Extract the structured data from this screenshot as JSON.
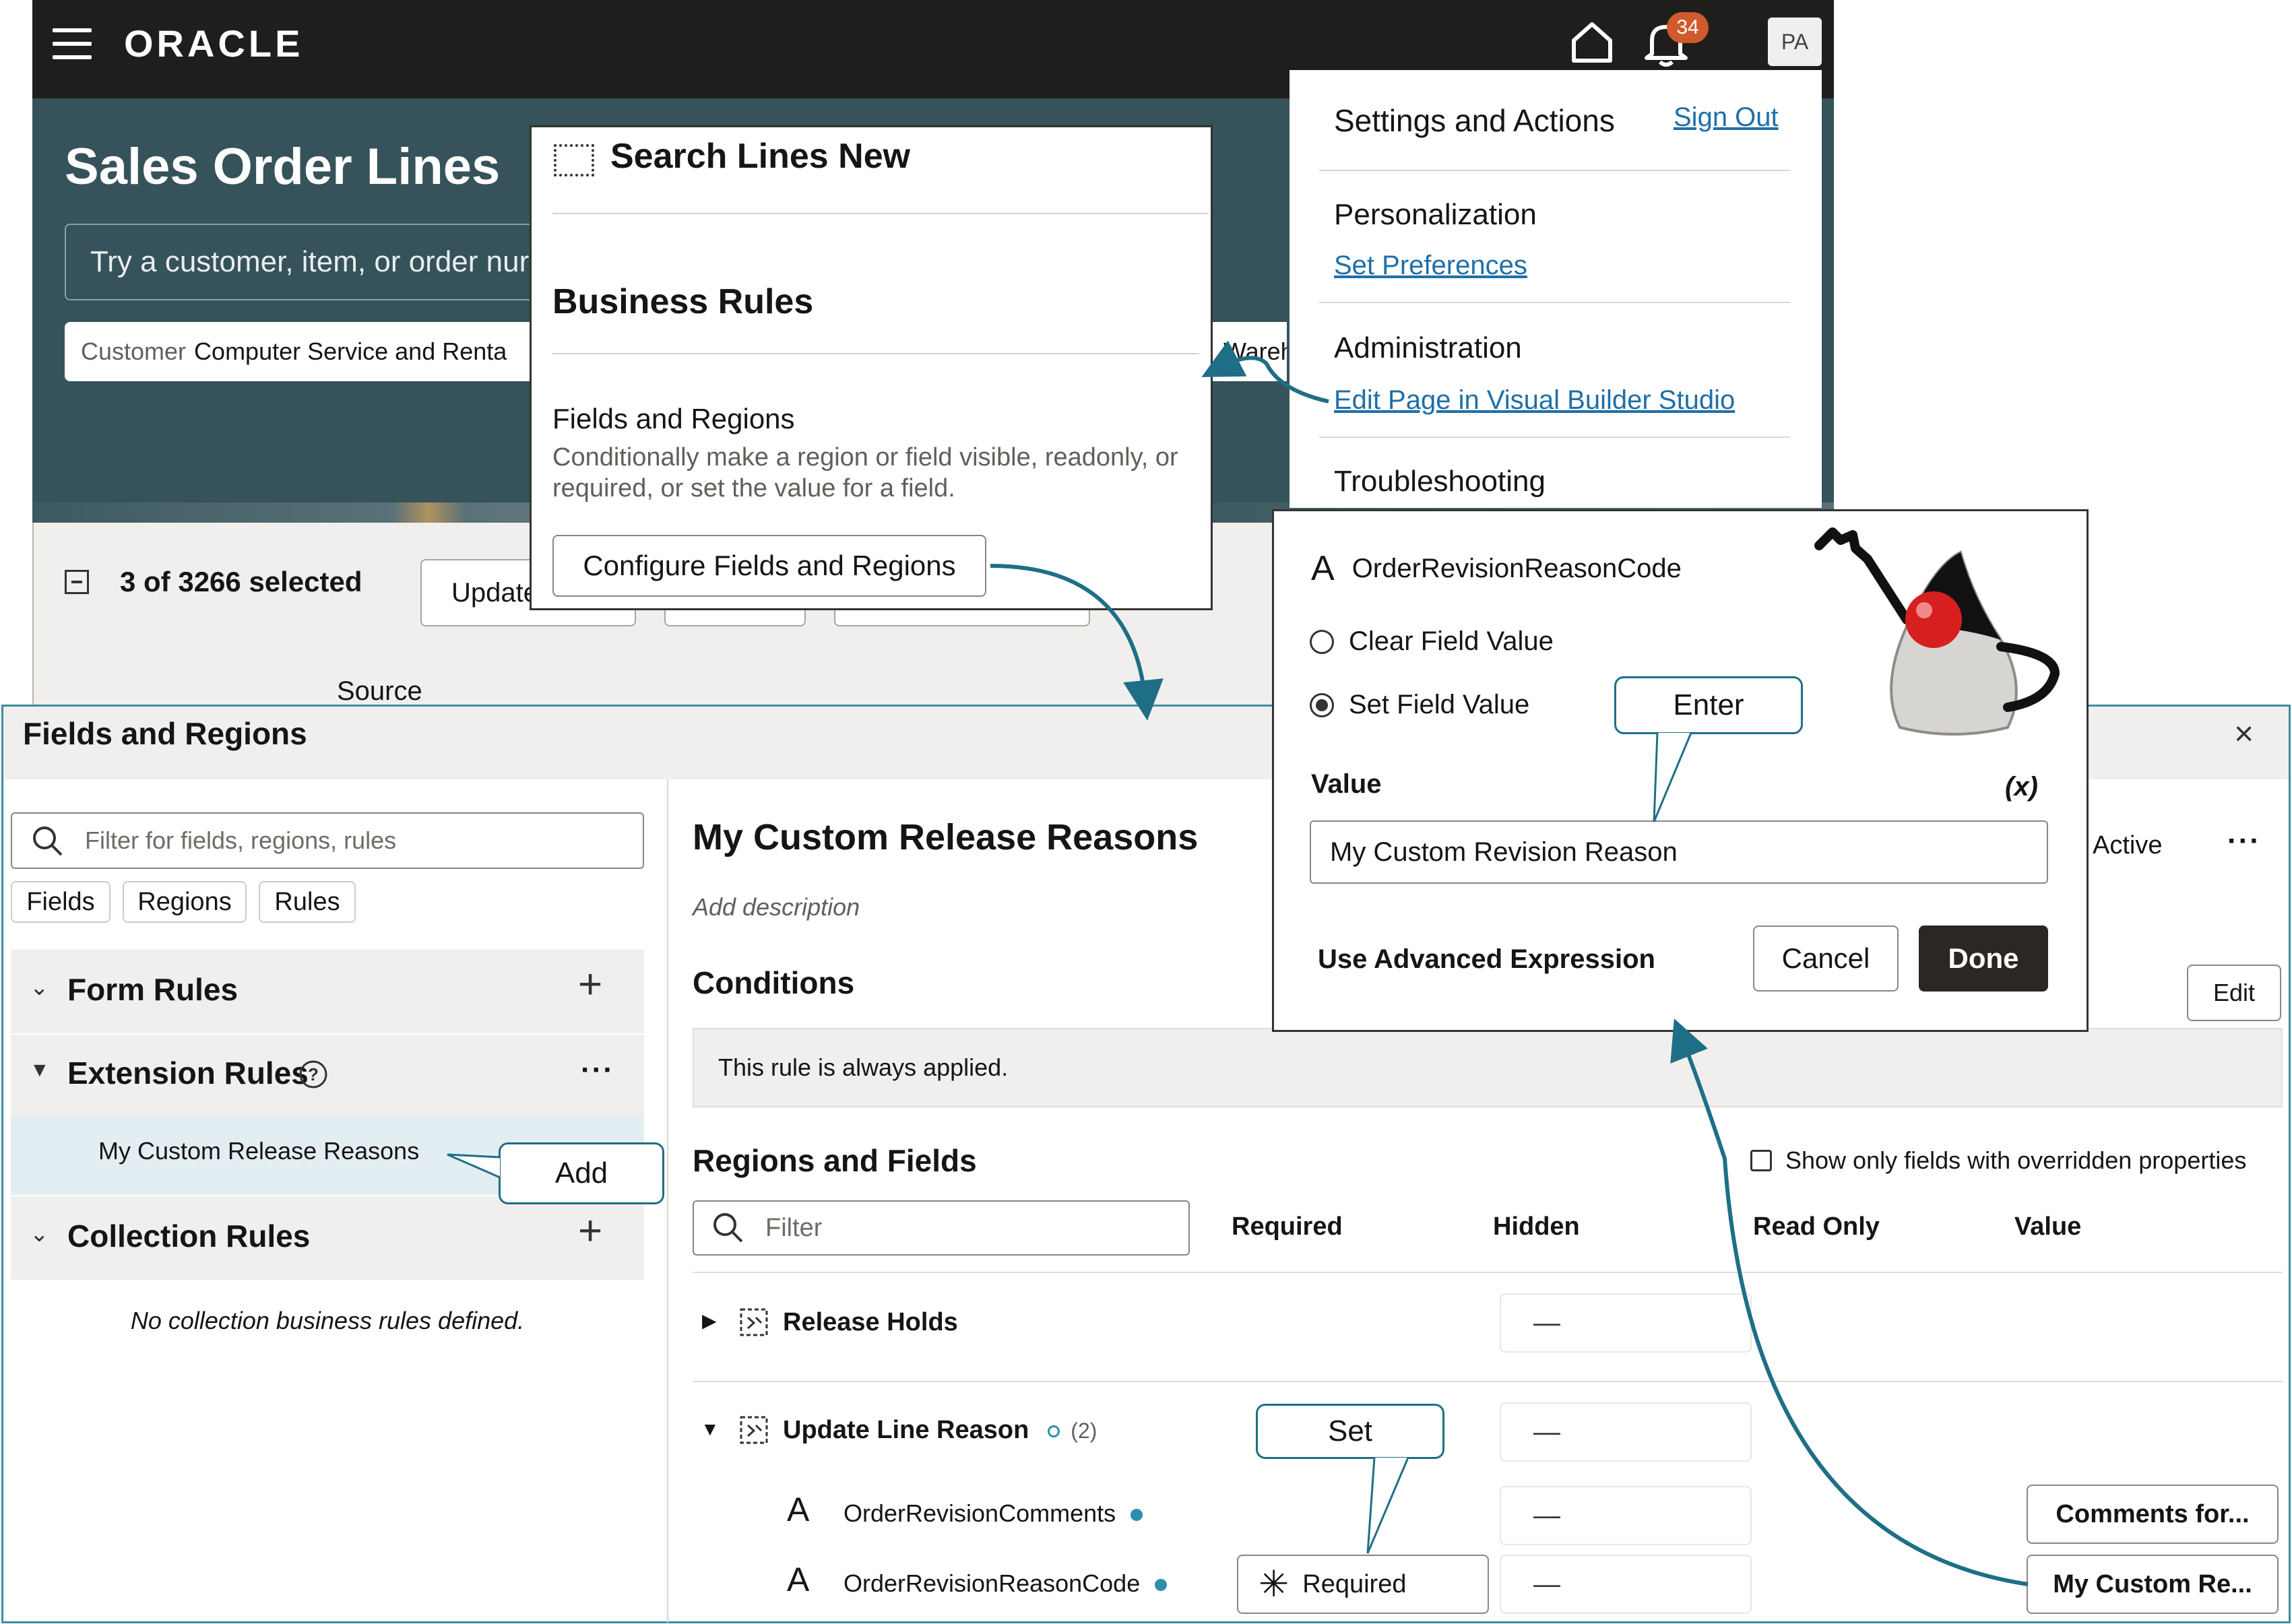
{
  "header": {
    "logo": "ORACLE",
    "notification_count": "34",
    "avatar_initials": "PA"
  },
  "page": {
    "title": "Sales Order Lines",
    "search_placeholder": "Try a customer, item, or order nur",
    "customer_chip_label": "Customer",
    "customer_chip_value": "Computer Service and Renta",
    "warehouse_chip": "Wareh",
    "selection_text": "3 of 3266 selected",
    "update_button": "Update",
    "source_label": "Source"
  },
  "search_popup": {
    "title": "Search Lines New",
    "section_heading": "Business Rules",
    "fields_heading": "Fields and Regions",
    "fields_description": "Conditionally make a region or field visible, readonly, or required, or set the value for a field.",
    "configure_button": "Configure Fields and Regions"
  },
  "settings_menu": {
    "title": "Settings and Actions",
    "sign_out": "Sign Out",
    "personalization": "Personalization",
    "set_preferences": "Set Preferences",
    "administration": "Administration",
    "edit_page": "Edit Page in Visual Builder Studio",
    "troubleshooting": "Troubleshooting"
  },
  "fields_regions": {
    "title": "Fields and Regions",
    "close": "×",
    "filter_placeholder": "Filter for fields, regions, rules",
    "chips": [
      "Fields",
      "Regions",
      "Rules"
    ],
    "form_rules": "Form Rules",
    "extension_rules": "Extension Rules",
    "custom_rule": "My Custom Release Reasons",
    "collection_rules": "Collection Rules",
    "no_collection": "No collection business rules defined.",
    "rule_name": "My Custom Release Reasons",
    "add_description": "Add description",
    "active": "Active",
    "conditions": "Conditions",
    "edit": "Edit",
    "always_applied": "This rule is always applied.",
    "regions_title": "Regions and Fields",
    "show_overridden": "Show only fields with overridden properties",
    "filter2_placeholder": "Filter",
    "columns": [
      "Required",
      "Hidden",
      "Read Only",
      "Value"
    ],
    "release_holds": "Release Holds",
    "update_line_reason": "Update Line Reason",
    "update_count": "(2)",
    "field1": "OrderRevisionComments",
    "field2": "OrderRevisionReasonCode",
    "dash": "—",
    "field1_value": "Comments for...",
    "field2_value": "My Custom Re...",
    "required_label": "Required"
  },
  "value_popup": {
    "field_name": "OrderRevisionReasonCode",
    "clear_option": "Clear Field Value",
    "set_option": "Set Field Value",
    "value_label": "Value",
    "expression_icon": "(x)",
    "value_input": "My Custom Revision Reason",
    "advanced": "Use Advanced Expression",
    "cancel": "Cancel",
    "done": "Done"
  },
  "callouts": {
    "enter": "Enter",
    "add": "Add",
    "set": "Set"
  },
  "colors": {
    "topbar": "#201e1c",
    "hero": "#36525a",
    "link": "#1f6fa8",
    "callout_border": "#1e6f86",
    "done_button": "#2a2725"
  }
}
